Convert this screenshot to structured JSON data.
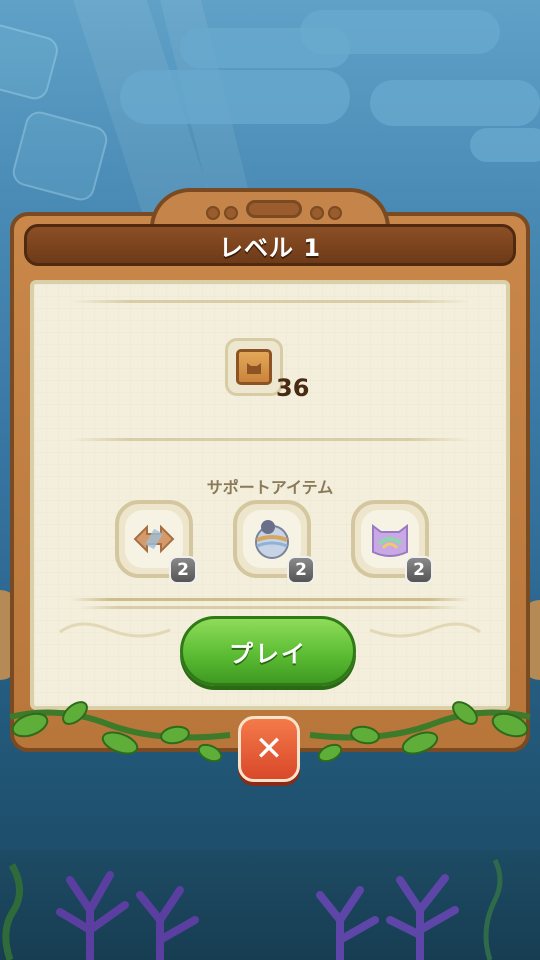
{
  "dialog": {
    "title": "レベル 1",
    "goal": {
      "icon": "wooden-crate-icon",
      "count": "36"
    },
    "support_label": "サポートアイテム",
    "items": [
      {
        "icon": "arrow-swap-icon",
        "count": "2"
      },
      {
        "icon": "bomb-ball-icon",
        "count": "2"
      },
      {
        "icon": "rainbow-cat-icon",
        "count": "2"
      }
    ],
    "play_label": "プレイ",
    "close_icon": "close-icon"
  },
  "colors": {
    "frame_wood": "#c5854a",
    "title_bar": "#7a4220",
    "paper": "#f3efdc",
    "play_green": "#5cbd33",
    "close_red": "#e0552f"
  }
}
